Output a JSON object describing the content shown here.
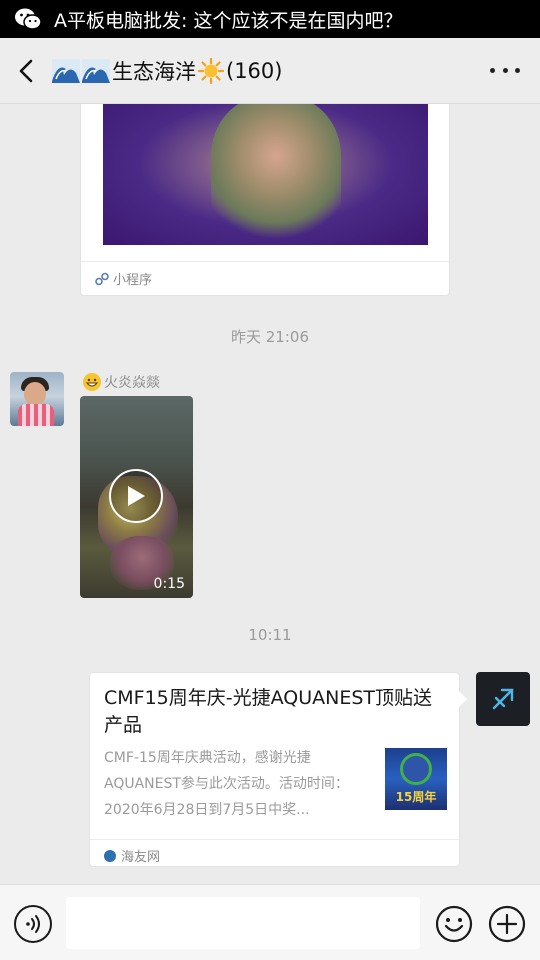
{
  "notification": {
    "text": "A平板电脑批发: 这个应该不是在国内吧？",
    "icon": "wechat-icon"
  },
  "header": {
    "title": "生态海洋",
    "member_count": "(160)",
    "back_icon": "back-chevron-icon",
    "more_icon": "more-dots-icon"
  },
  "messages": {
    "mini_program_card": {
      "label": "小程序"
    },
    "timestamp_yesterday": "昨天 21:06",
    "video_message": {
      "sender_name": "火炎焱燚",
      "duration": "0:15"
    },
    "timestamp_today": "10:11",
    "link_card": {
      "title": "CMF15周年庆-光捷AQUANEST顶贴送产品",
      "description": "CMF-15周年庆典活动，感谢光捷AQUANEST参与此次活动。活动时间：2020年6月28日到7月5日中奖...",
      "thumb_text": "15周年",
      "source": "海友网"
    }
  },
  "input_bar": {
    "placeholder": "",
    "voice_icon": "voice-icon",
    "emoji_icon": "emoji-icon",
    "plus_icon": "plus-icon"
  },
  "colors": {
    "chat_background": "#ebebeb",
    "header_background": "#ededed",
    "notification_background": "#000000"
  }
}
